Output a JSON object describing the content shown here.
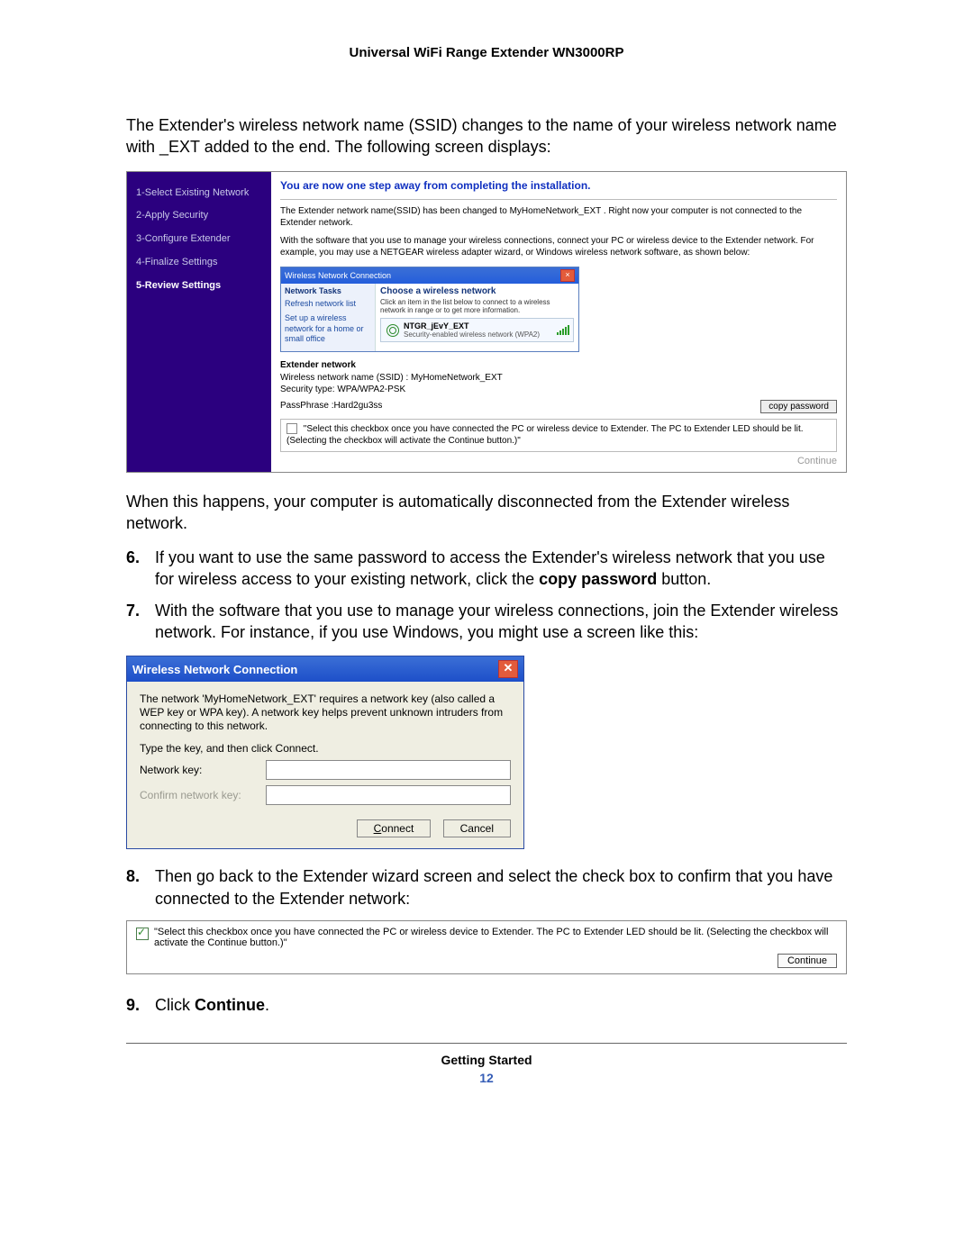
{
  "header": {
    "doc_title": "Universal WiFi Range Extender WN3000RP"
  },
  "p_intro": "The Extender's wireless network name (SSID) changes to the name of your wireless network name with _EXT added to the end. The following screen displays:",
  "wizard": {
    "steps": [
      "1-Select Existing Network",
      "2-Apply Security",
      "3-Configure Extender",
      "4-Finalize Settings",
      "5-Review Settings"
    ],
    "headline": "You are now one step away from completing the installation.",
    "renamed": "The Extender network name(SSID) has been changed to MyHomeNetwork_EXT . Right now your computer is not connected to the Extender network.",
    "instr": "With the software that you use to manage your wireless connections, connect your PC or wireless device to the Extender network. For example, you may use a NETGEAR wireless adapter wizard, or Windows wireless network software, as shown below:",
    "xp_mini": {
      "title": "Wireless Network Connection",
      "left_header": "Network Tasks",
      "refresh": "Refresh network list",
      "setup": "Set up a wireless network for a home or small office",
      "choose_hdr": "Choose a wireless network",
      "choose_hint": "Click an item in the list below to connect to a wireless network in range or to get more information.",
      "net_name": "NTGR_jEvY_EXT",
      "net_sec": "Security-enabled wireless network (WPA2)"
    },
    "ext_hdr": "Extender network",
    "ssid_line": "Wireless network name (SSID) : MyHomeNetwork_EXT",
    "sectype_line": "Security type: WPA/WPA2-PSK",
    "pass_line": "PassPhrase :Hard2gu3ss",
    "copy_btn": "copy password",
    "checkbox_note": "\"Select this checkbox once you have connected the PC or wireless device to Extender. The PC to Extender LED should be lit. (Selecting the checkbox will activate the Continue button.)\"",
    "continue_label": "Continue"
  },
  "p_after_wizard": "When this happens, your computer is automatically disconnected from the Extender wireless network.",
  "steps": {
    "s6_num": "6.",
    "s6_a": "If you want to use the same password to access the Extender's wireless network that you use for wireless access to your existing network, click the ",
    "s6_bold": "copy password",
    "s6_b": " button.",
    "s7_num": "7.",
    "s7": "With the software that you use to manage your wireless connections, join the Extender wireless network. For instance, if you use Windows, you might use a screen like this:",
    "s8_num": "8.",
    "s8": "Then go back to the Extender wizard screen and select the check box to confirm that you have connected to the Extender network:",
    "s9_num": "9.",
    "s9_a": "Click ",
    "s9_bold": "Continue",
    "s9_b": "."
  },
  "xp_dialog": {
    "title": "Wireless Network Connection",
    "desc": "The network 'MyHomeNetwork_EXT' requires a network key (also called a WEP key or WPA key). A network key helps prevent unknown intruders from connecting to this network.",
    "type_hint": "Type the key, and then click Connect.",
    "label_key": "Network key:",
    "label_confirm": "Confirm network key:",
    "btn_connect": "Connect",
    "btn_cancel": "Cancel"
  },
  "confirm_box": {
    "text": "\"Select this checkbox once you have connected the PC or wireless device to Extender. The PC to Extender LED should be lit. (Selecting the checkbox will activate the Continue button.)\"",
    "btn": "Continue"
  },
  "footer": {
    "section": "Getting Started",
    "page": "12"
  }
}
